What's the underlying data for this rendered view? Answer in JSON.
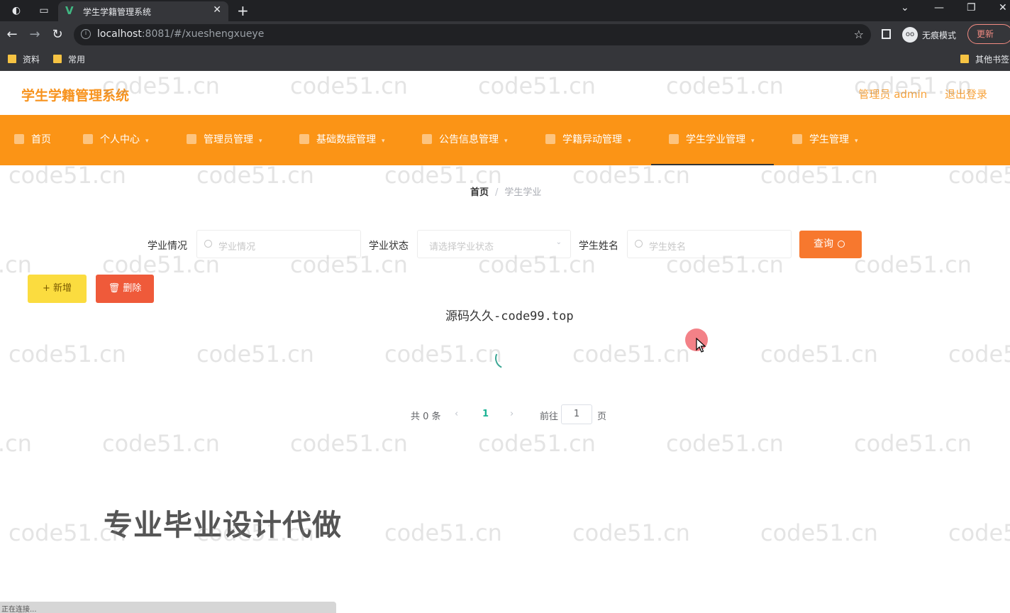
{
  "browser": {
    "tab_title": "学生学籍管理系统",
    "url_host": "localhost",
    "url_rest": ":8081/#/xueshengxueye",
    "incognito_label": "无痕模式",
    "update_label": "更新",
    "bookmarks": [
      "资料",
      "常用"
    ],
    "other_bookmarks": "其他书签"
  },
  "header": {
    "app_title": "学生学籍管理系统",
    "user_label": "管理员 admin",
    "logout_label": "退出登录"
  },
  "nav": {
    "items": [
      {
        "label": "首页"
      },
      {
        "label": "个人中心"
      },
      {
        "label": "管理员管理"
      },
      {
        "label": "基础数据管理"
      },
      {
        "label": "公告信息管理"
      },
      {
        "label": "学籍异动管理"
      },
      {
        "label": "学生学业管理"
      },
      {
        "label": "学生管理"
      }
    ],
    "active_index": 6
  },
  "breadcrumb": {
    "home": "首页",
    "separator": "/",
    "current": "学生学业"
  },
  "search": {
    "field1_label": "学业情况",
    "field1_placeholder": "学业情况",
    "field2_label": "学业状态",
    "field2_placeholder": "请选择学业状态",
    "field3_label": "学生姓名",
    "field3_placeholder": "学生姓名",
    "query_label": "查询"
  },
  "actions": {
    "add_label": "+ 新增",
    "delete_label": "删除"
  },
  "overlay_text": "源码久久-code99.top",
  "pagination": {
    "total_text": "共 0 条",
    "current_page": "1",
    "goto_label": "前往",
    "goto_value": "1",
    "page_suffix": "页"
  },
  "promo_text": "专业毕业设计代做",
  "status_text": "正在连接...",
  "watermark_text": "code51.cn",
  "colors": {
    "nav_bg": "#fb9416",
    "title": "#f7931e",
    "query_btn": "#f7782e",
    "add_btn": "#fbdc3f",
    "delete_btn": "#ef5a3a",
    "pagination_active": "#1bb394"
  }
}
